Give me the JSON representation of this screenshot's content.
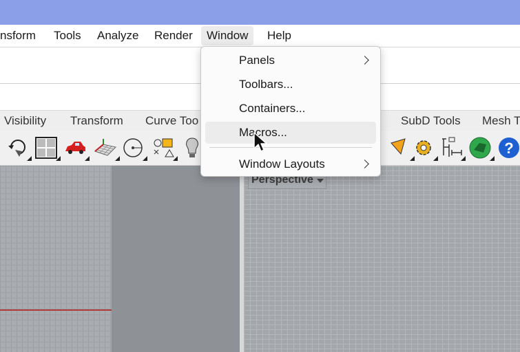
{
  "menubar": {
    "items": [
      "nsform",
      "Tools",
      "Analyze",
      "Render",
      "Window",
      "Help"
    ],
    "active": "Window"
  },
  "window_menu": {
    "items": [
      {
        "label": "Panels",
        "submenu": true
      },
      {
        "label": "Toolbars...",
        "submenu": false
      },
      {
        "label": "Containers...",
        "submenu": false
      },
      {
        "label": "Macros...",
        "submenu": false,
        "hovered": true
      },
      {
        "label": "Window Layouts",
        "submenu": true
      }
    ]
  },
  "tabs": [
    "Visibility",
    "Transform",
    "Curve Too",
    "SubD Tools",
    "Mesh T"
  ],
  "toolbar_icons": [
    "rotate-view-icon",
    "four-viewports-icon",
    "car-icon",
    "grid-plane-icon",
    "circle-point-icon",
    "shapes-icon",
    "light-bulb-icon",
    "cone-icon",
    "gear-icon",
    "dimension-icon",
    "globe-icon",
    "help-icon"
  ],
  "viewport": {
    "right_label": "Perspective"
  },
  "colors": {
    "titlebar": "#8a9fe8",
    "axis_red": "#b33a3a",
    "help_blue": "#1e5fd1"
  }
}
